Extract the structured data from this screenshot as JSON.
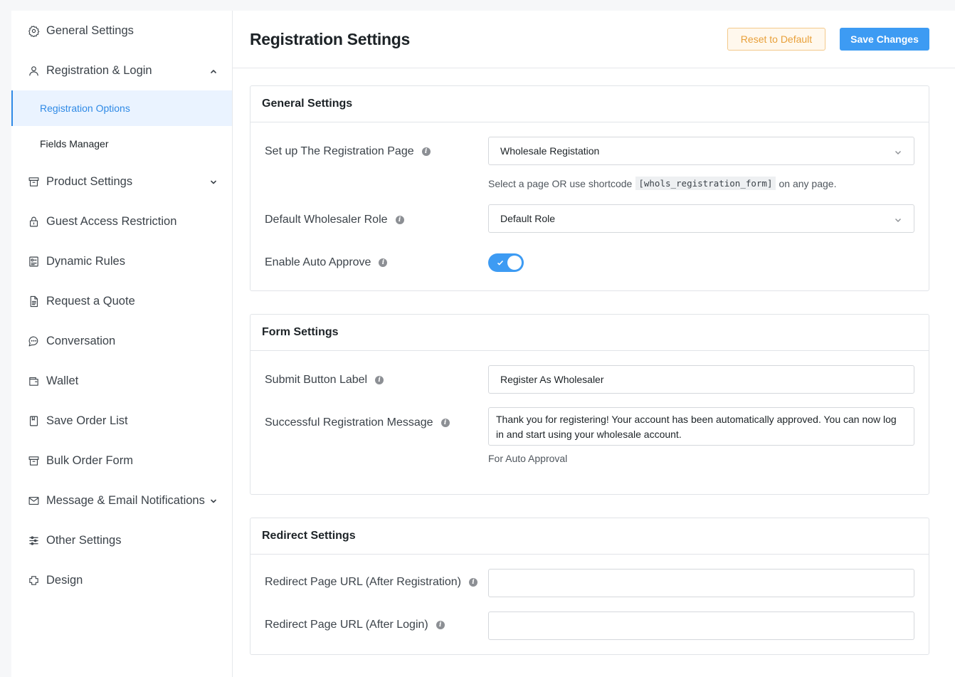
{
  "sidebar": {
    "items": [
      {
        "label": "General Settings",
        "icon": "gear-icon"
      },
      {
        "label": "Registration & Login",
        "icon": "user-icon",
        "expanded": true
      },
      {
        "label": "Product Settings",
        "icon": "archive-icon"
      },
      {
        "label": "Guest Access Restriction",
        "icon": "lock-icon"
      },
      {
        "label": "Dynamic Rules",
        "icon": "rules-icon"
      },
      {
        "label": "Request a Quote",
        "icon": "document-icon"
      },
      {
        "label": "Conversation",
        "icon": "chat-icon"
      },
      {
        "label": "Wallet",
        "icon": "wallet-icon"
      },
      {
        "label": "Save Order List",
        "icon": "bookmark-icon"
      },
      {
        "label": "Bulk Order Form",
        "icon": "box-icon"
      },
      {
        "label": "Message & Email Notifications",
        "icon": "mail-icon"
      },
      {
        "label": "Other Settings",
        "icon": "sliders-icon"
      },
      {
        "label": "Design",
        "icon": "design-icon"
      }
    ],
    "sub_items": [
      {
        "label": "Registration Options",
        "active": true
      },
      {
        "label": "Fields Manager",
        "active": false
      }
    ]
  },
  "header": {
    "title": "Registration Settings",
    "reset_label": "Reset to Default",
    "save_label": "Save Changes"
  },
  "general": {
    "title": "General Settings",
    "reg_page_label": "Set up The Registration Page",
    "reg_page_value": "Wholesale Registation",
    "help_prefix": "Select a page OR use shortcode",
    "help_code": "[whols_registration_form]",
    "help_suffix": "on any page.",
    "role_label": "Default Wholesaler Role",
    "role_value": "Default Role",
    "auto_approve_label": "Enable Auto Approve",
    "auto_approve_on": true
  },
  "form": {
    "title": "Form Settings",
    "submit_label": "Submit Button Label",
    "submit_value": "Register As Wholesaler",
    "message_label": "Successful Registration Message",
    "message_value": "Thank you for registering! Your account has been automatically approved. You can now log in and start using your wholesale account.",
    "message_help": "For Auto Approval"
  },
  "redirect": {
    "title": "Redirect Settings",
    "after_reg_label": "Redirect Page URL (After Registration)",
    "after_reg_value": "",
    "after_login_label": "Redirect Page URL (After Login)",
    "after_login_value": ""
  },
  "colors": {
    "accent": "#3d9bf3",
    "reset_text": "#e8a03a",
    "active_bg": "#eaf3ff"
  }
}
